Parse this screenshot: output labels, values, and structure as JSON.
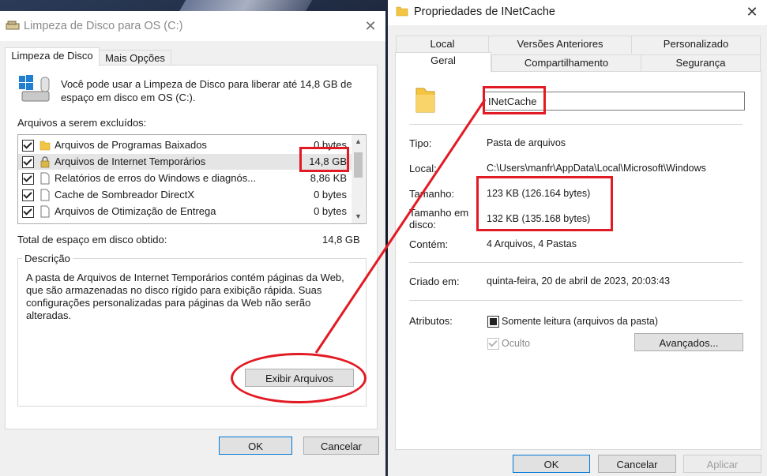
{
  "disk_cleanup": {
    "title": "Limpeza de Disco para OS (C:)",
    "tabs": [
      "Limpeza de Disco",
      "Mais Opções"
    ],
    "intro": "Você pode usar a Limpeza de Disco para liberar até 14,8 GB de espaço em disco em OS (C:).",
    "files_label": "Arquivos a serem excluídos:",
    "items": [
      {
        "name": "Arquivos de Programas Baixados",
        "size": "0 bytes",
        "icon": "folder-icon",
        "checked": true
      },
      {
        "name": "Arquivos de Internet Temporários",
        "size": "14,8 GB",
        "icon": "lock-icon",
        "checked": true
      },
      {
        "name": "Relatórios de erros do Windows e diagnós...",
        "size": "8,86 KB",
        "icon": "file-icon",
        "checked": true
      },
      {
        "name": "Cache de Sombreador DirectX",
        "size": "0 bytes",
        "icon": "file-icon",
        "checked": true
      },
      {
        "name": "Arquivos de Otimização de Entrega",
        "size": "0 bytes",
        "icon": "file-icon",
        "checked": true
      }
    ],
    "total_label": "Total de espaço em disco obtido:",
    "total_value": "14,8 GB",
    "description_legend": "Descrição",
    "description_text": "A pasta de Arquivos de Internet Temporários contém páginas da Web, que são armazenadas no disco rígido para exibição rápida. Suas configurações personalizadas para páginas da Web não serão alteradas.",
    "view_files_button": "Exibir Arquivos",
    "ok_button": "OK",
    "cancel_button": "Cancelar"
  },
  "properties": {
    "title": "Propriedades de INetCache",
    "tabs_row1": [
      "Local",
      "Versões Anteriores",
      "Personalizado"
    ],
    "tabs_row2": [
      "Geral",
      "Compartilhamento",
      "Segurança"
    ],
    "folder_name": "INetCache",
    "type_label": "Tipo:",
    "type_value": "Pasta de arquivos",
    "location_label": "Local:",
    "location_value": "C:\\Users\\manfr\\AppData\\Local\\Microsoft\\Windows",
    "size_label": "Tamanho:",
    "size_value": "123 KB (126.164 bytes)",
    "disk_size_label": "Tamanho em disco:",
    "disk_size_value": "132 KB (135.168 bytes)",
    "contains_label": "Contém:",
    "contains_value": "4 Arquivos, 4 Pastas",
    "created_label": "Criado em:",
    "created_value": "quinta-feira, 20 de abril de 2023, 20:03:43",
    "attributes_label": "Atributos:",
    "readonly_label": "Somente leitura (arquivos da pasta)",
    "hidden_label": "Oculto",
    "advanced_button": "Avançados...",
    "ok_button": "OK",
    "cancel_button": "Cancelar",
    "apply_button": "Aplicar"
  },
  "colors": {
    "annotation_red": "#e21a23",
    "accent_blue": "#0078d7",
    "folder_yellow": "#f4c542"
  }
}
